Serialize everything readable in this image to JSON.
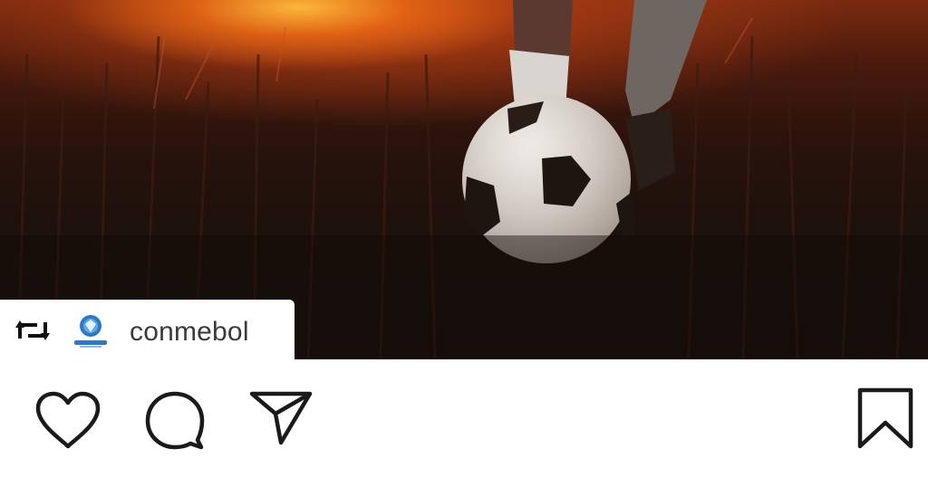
{
  "repost": {
    "username": "conmebol",
    "repost_icon": "repost-icon",
    "account_logo": "conmebol-logo"
  },
  "media": {
    "description_type": "video-frame",
    "subject_icons": [
      "soccer-ball",
      "legs",
      "grass",
      "sunset"
    ]
  },
  "actions": {
    "like_icon": "heart-icon",
    "comment_icon": "comment-icon",
    "share_icon": "paper-plane-icon",
    "save_icon": "bookmark-icon"
  },
  "colors": {
    "icon": "#1a1a1a",
    "background": "#ffffff",
    "sunset": "#f07820"
  }
}
